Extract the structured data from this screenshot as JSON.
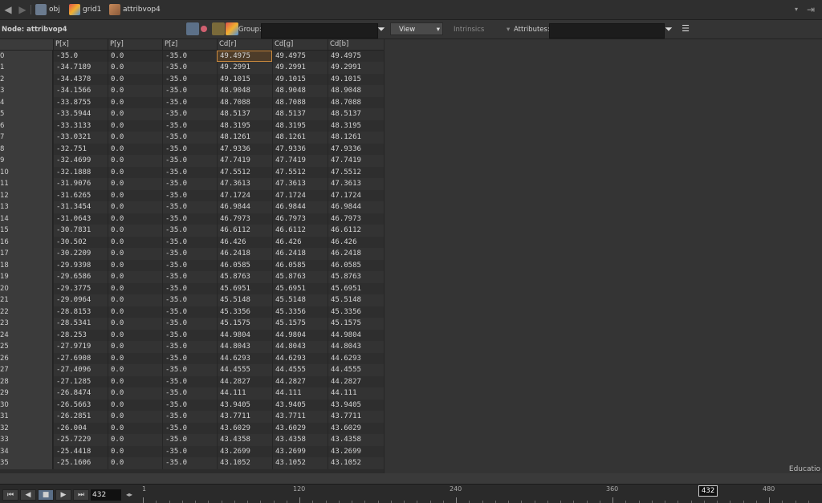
{
  "pathbar": {
    "crumbs": [
      "obj",
      "grid1",
      "attribvop4"
    ]
  },
  "toolbar": {
    "node_label": "Node: attribvop4",
    "group_label": "Group:",
    "group_value": "",
    "view_label": "View",
    "intrinsics_label": "Intrinsics",
    "attributes_label": "Attributes:",
    "attributes_value": ""
  },
  "table": {
    "columns": [
      "P[x]",
      "P[y]",
      "P[z]",
      "Cd[r]",
      "Cd[g]",
      "Cd[b]"
    ],
    "rows": [
      [
        "0",
        "-35.0",
        "0.0",
        "-35.0",
        "49.4975",
        "49.4975",
        "49.4975"
      ],
      [
        "1",
        "-34.7189",
        "0.0",
        "-35.0",
        "49.2991",
        "49.2991",
        "49.2991"
      ],
      [
        "2",
        "-34.4378",
        "0.0",
        "-35.0",
        "49.1015",
        "49.1015",
        "49.1015"
      ],
      [
        "3",
        "-34.1566",
        "0.0",
        "-35.0",
        "48.9048",
        "48.9048",
        "48.9048"
      ],
      [
        "4",
        "-33.8755",
        "0.0",
        "-35.0",
        "48.7088",
        "48.7088",
        "48.7088"
      ],
      [
        "5",
        "-33.5944",
        "0.0",
        "-35.0",
        "48.5137",
        "48.5137",
        "48.5137"
      ],
      [
        "6",
        "-33.3133",
        "0.0",
        "-35.0",
        "48.3195",
        "48.3195",
        "48.3195"
      ],
      [
        "7",
        "-33.0321",
        "0.0",
        "-35.0",
        "48.1261",
        "48.1261",
        "48.1261"
      ],
      [
        "8",
        "-32.751",
        "0.0",
        "-35.0",
        "47.9336",
        "47.9336",
        "47.9336"
      ],
      [
        "9",
        "-32.4699",
        "0.0",
        "-35.0",
        "47.7419",
        "47.7419",
        "47.7419"
      ],
      [
        "10",
        "-32.1888",
        "0.0",
        "-35.0",
        "47.5512",
        "47.5512",
        "47.5512"
      ],
      [
        "11",
        "-31.9076",
        "0.0",
        "-35.0",
        "47.3613",
        "47.3613",
        "47.3613"
      ],
      [
        "12",
        "-31.6265",
        "0.0",
        "-35.0",
        "47.1724",
        "47.1724",
        "47.1724"
      ],
      [
        "13",
        "-31.3454",
        "0.0",
        "-35.0",
        "46.9844",
        "46.9844",
        "46.9844"
      ],
      [
        "14",
        "-31.0643",
        "0.0",
        "-35.0",
        "46.7973",
        "46.7973",
        "46.7973"
      ],
      [
        "15",
        "-30.7831",
        "0.0",
        "-35.0",
        "46.6112",
        "46.6112",
        "46.6112"
      ],
      [
        "16",
        "-30.502",
        "0.0",
        "-35.0",
        "46.426",
        "46.426",
        "46.426"
      ],
      [
        "17",
        "-30.2209",
        "0.0",
        "-35.0",
        "46.2418",
        "46.2418",
        "46.2418"
      ],
      [
        "18",
        "-29.9398",
        "0.0",
        "-35.0",
        "46.0585",
        "46.0585",
        "46.0585"
      ],
      [
        "19",
        "-29.6586",
        "0.0",
        "-35.0",
        "45.8763",
        "45.8763",
        "45.8763"
      ],
      [
        "20",
        "-29.3775",
        "0.0",
        "-35.0",
        "45.6951",
        "45.6951",
        "45.6951"
      ],
      [
        "21",
        "-29.0964",
        "0.0",
        "-35.0",
        "45.5148",
        "45.5148",
        "45.5148"
      ],
      [
        "22",
        "-28.8153",
        "0.0",
        "-35.0",
        "45.3356",
        "45.3356",
        "45.3356"
      ],
      [
        "23",
        "-28.5341",
        "0.0",
        "-35.0",
        "45.1575",
        "45.1575",
        "45.1575"
      ],
      [
        "24",
        "-28.253",
        "0.0",
        "-35.0",
        "44.9804",
        "44.9804",
        "44.9804"
      ],
      [
        "25",
        "-27.9719",
        "0.0",
        "-35.0",
        "44.8043",
        "44.8043",
        "44.8043"
      ],
      [
        "26",
        "-27.6908",
        "0.0",
        "-35.0",
        "44.6293",
        "44.6293",
        "44.6293"
      ],
      [
        "27",
        "-27.4096",
        "0.0",
        "-35.0",
        "44.4555",
        "44.4555",
        "44.4555"
      ],
      [
        "28",
        "-27.1285",
        "0.0",
        "-35.0",
        "44.2827",
        "44.2827",
        "44.2827"
      ],
      [
        "29",
        "-26.8474",
        "0.0",
        "-35.0",
        "44.111",
        "44.111",
        "44.111"
      ],
      [
        "30",
        "-26.5663",
        "0.0",
        "-35.0",
        "43.9405",
        "43.9405",
        "43.9405"
      ],
      [
        "31",
        "-26.2851",
        "0.0",
        "-35.0",
        "43.7711",
        "43.7711",
        "43.7711"
      ],
      [
        "32",
        "-26.004",
        "0.0",
        "-35.0",
        "43.6029",
        "43.6029",
        "43.6029"
      ],
      [
        "33",
        "-25.7229",
        "0.0",
        "-35.0",
        "43.4358",
        "43.4358",
        "43.4358"
      ],
      [
        "34",
        "-25.4418",
        "0.0",
        "-35.0",
        "43.2699",
        "43.2699",
        "43.2699"
      ],
      [
        "35",
        "-25.1606",
        "0.0",
        "-35.0",
        "43.1052",
        "43.1052",
        "43.1052"
      ]
    ]
  },
  "watermark": "Educatio",
  "timeline": {
    "frame_value": "432",
    "current_frame": "432",
    "ruler_labels": [
      "1",
      "120",
      "240",
      "360",
      "480"
    ],
    "buttons": [
      "⏮",
      "◀",
      "■",
      "▶",
      "⏭"
    ]
  },
  "colors": {
    "selection": "#c9883d",
    "accent": "#5a6e86"
  }
}
